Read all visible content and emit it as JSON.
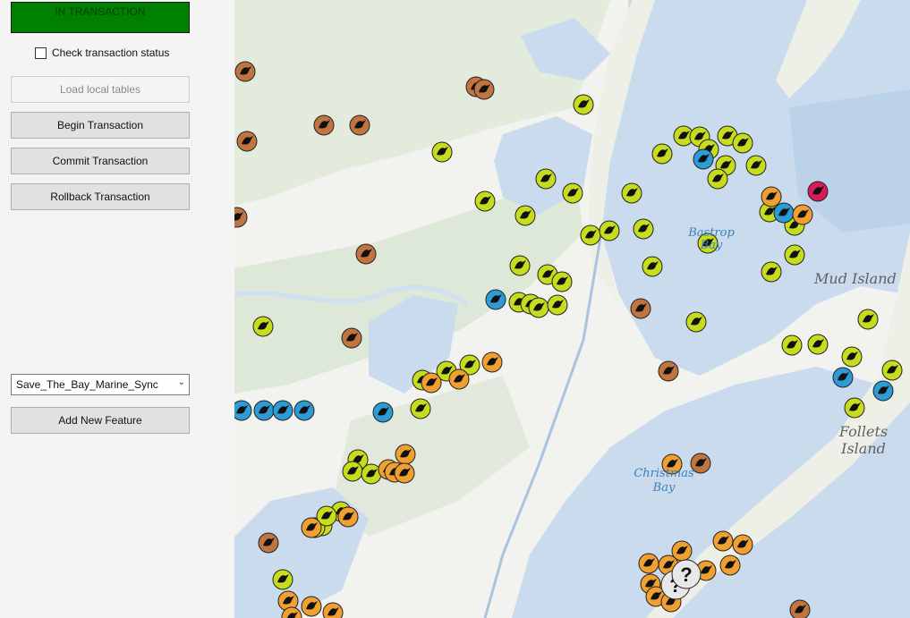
{
  "panel": {
    "status": "IN TRANSACTION",
    "check_label": "Check transaction status",
    "load_button": "Load local tables",
    "begin_button": "Begin Transaction",
    "commit_button": "Commit Transaction",
    "rollback_button": "Rollback Transaction",
    "dropdown_value": "Save_The_Bay_Marine_Sync",
    "add_button": "Add New Feature"
  },
  "map": {
    "labels": {
      "bastrop": "Bastrop Bay",
      "christmas": "Christmas Bay",
      "mud": "Mud Island",
      "follets": "Follets Island"
    },
    "colors": {
      "water": "#c9dbec",
      "land": "#f2f2ee",
      "marsh": "#dde8d8",
      "bird": "#c6dc1c",
      "mammal": "#c07440",
      "fish": "#2d9bd6",
      "invertebrate": "#f0a030",
      "reptile": "#d81b5a",
      "unknown": "#e8e8e8"
    }
  }
}
